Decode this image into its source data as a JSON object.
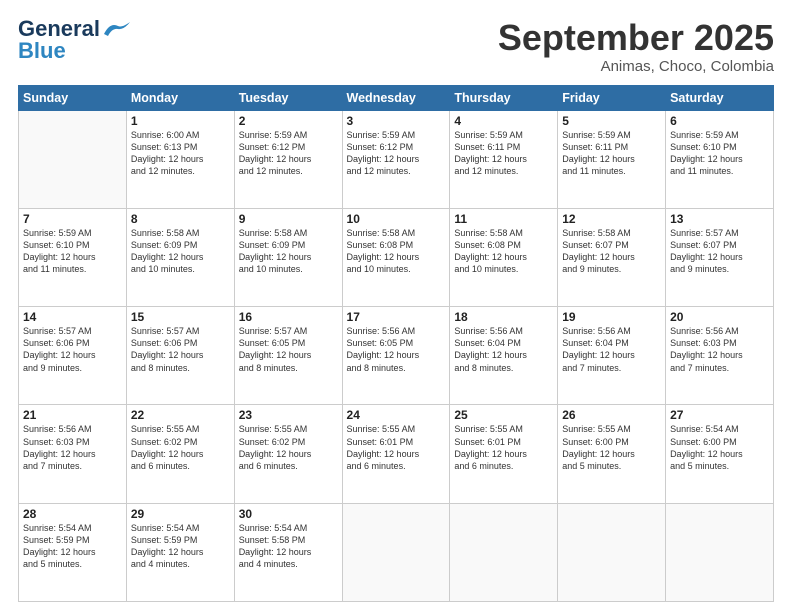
{
  "header": {
    "logo_general": "General",
    "logo_blue": "Blue",
    "title": "September 2025",
    "subtitle": "Animas, Choco, Colombia"
  },
  "weekdays": [
    "Sunday",
    "Monday",
    "Tuesday",
    "Wednesday",
    "Thursday",
    "Friday",
    "Saturday"
  ],
  "weeks": [
    [
      {
        "day": "",
        "info": ""
      },
      {
        "day": "1",
        "info": "Sunrise: 6:00 AM\nSunset: 6:13 PM\nDaylight: 12 hours\nand 12 minutes."
      },
      {
        "day": "2",
        "info": "Sunrise: 5:59 AM\nSunset: 6:12 PM\nDaylight: 12 hours\nand 12 minutes."
      },
      {
        "day": "3",
        "info": "Sunrise: 5:59 AM\nSunset: 6:12 PM\nDaylight: 12 hours\nand 12 minutes."
      },
      {
        "day": "4",
        "info": "Sunrise: 5:59 AM\nSunset: 6:11 PM\nDaylight: 12 hours\nand 12 minutes."
      },
      {
        "day": "5",
        "info": "Sunrise: 5:59 AM\nSunset: 6:11 PM\nDaylight: 12 hours\nand 11 minutes."
      },
      {
        "day": "6",
        "info": "Sunrise: 5:59 AM\nSunset: 6:10 PM\nDaylight: 12 hours\nand 11 minutes."
      }
    ],
    [
      {
        "day": "7",
        "info": "Sunrise: 5:59 AM\nSunset: 6:10 PM\nDaylight: 12 hours\nand 11 minutes."
      },
      {
        "day": "8",
        "info": "Sunrise: 5:58 AM\nSunset: 6:09 PM\nDaylight: 12 hours\nand 10 minutes."
      },
      {
        "day": "9",
        "info": "Sunrise: 5:58 AM\nSunset: 6:09 PM\nDaylight: 12 hours\nand 10 minutes."
      },
      {
        "day": "10",
        "info": "Sunrise: 5:58 AM\nSunset: 6:08 PM\nDaylight: 12 hours\nand 10 minutes."
      },
      {
        "day": "11",
        "info": "Sunrise: 5:58 AM\nSunset: 6:08 PM\nDaylight: 12 hours\nand 10 minutes."
      },
      {
        "day": "12",
        "info": "Sunrise: 5:58 AM\nSunset: 6:07 PM\nDaylight: 12 hours\nand 9 minutes."
      },
      {
        "day": "13",
        "info": "Sunrise: 5:57 AM\nSunset: 6:07 PM\nDaylight: 12 hours\nand 9 minutes."
      }
    ],
    [
      {
        "day": "14",
        "info": "Sunrise: 5:57 AM\nSunset: 6:06 PM\nDaylight: 12 hours\nand 9 minutes."
      },
      {
        "day": "15",
        "info": "Sunrise: 5:57 AM\nSunset: 6:06 PM\nDaylight: 12 hours\nand 8 minutes."
      },
      {
        "day": "16",
        "info": "Sunrise: 5:57 AM\nSunset: 6:05 PM\nDaylight: 12 hours\nand 8 minutes."
      },
      {
        "day": "17",
        "info": "Sunrise: 5:56 AM\nSunset: 6:05 PM\nDaylight: 12 hours\nand 8 minutes."
      },
      {
        "day": "18",
        "info": "Sunrise: 5:56 AM\nSunset: 6:04 PM\nDaylight: 12 hours\nand 8 minutes."
      },
      {
        "day": "19",
        "info": "Sunrise: 5:56 AM\nSunset: 6:04 PM\nDaylight: 12 hours\nand 7 minutes."
      },
      {
        "day": "20",
        "info": "Sunrise: 5:56 AM\nSunset: 6:03 PM\nDaylight: 12 hours\nand 7 minutes."
      }
    ],
    [
      {
        "day": "21",
        "info": "Sunrise: 5:56 AM\nSunset: 6:03 PM\nDaylight: 12 hours\nand 7 minutes."
      },
      {
        "day": "22",
        "info": "Sunrise: 5:55 AM\nSunset: 6:02 PM\nDaylight: 12 hours\nand 6 minutes."
      },
      {
        "day": "23",
        "info": "Sunrise: 5:55 AM\nSunset: 6:02 PM\nDaylight: 12 hours\nand 6 minutes."
      },
      {
        "day": "24",
        "info": "Sunrise: 5:55 AM\nSunset: 6:01 PM\nDaylight: 12 hours\nand 6 minutes."
      },
      {
        "day": "25",
        "info": "Sunrise: 5:55 AM\nSunset: 6:01 PM\nDaylight: 12 hours\nand 6 minutes."
      },
      {
        "day": "26",
        "info": "Sunrise: 5:55 AM\nSunset: 6:00 PM\nDaylight: 12 hours\nand 5 minutes."
      },
      {
        "day": "27",
        "info": "Sunrise: 5:54 AM\nSunset: 6:00 PM\nDaylight: 12 hours\nand 5 minutes."
      }
    ],
    [
      {
        "day": "28",
        "info": "Sunrise: 5:54 AM\nSunset: 5:59 PM\nDaylight: 12 hours\nand 5 minutes."
      },
      {
        "day": "29",
        "info": "Sunrise: 5:54 AM\nSunset: 5:59 PM\nDaylight: 12 hours\nand 4 minutes."
      },
      {
        "day": "30",
        "info": "Sunrise: 5:54 AM\nSunset: 5:58 PM\nDaylight: 12 hours\nand 4 minutes."
      },
      {
        "day": "",
        "info": ""
      },
      {
        "day": "",
        "info": ""
      },
      {
        "day": "",
        "info": ""
      },
      {
        "day": "",
        "info": ""
      }
    ]
  ]
}
